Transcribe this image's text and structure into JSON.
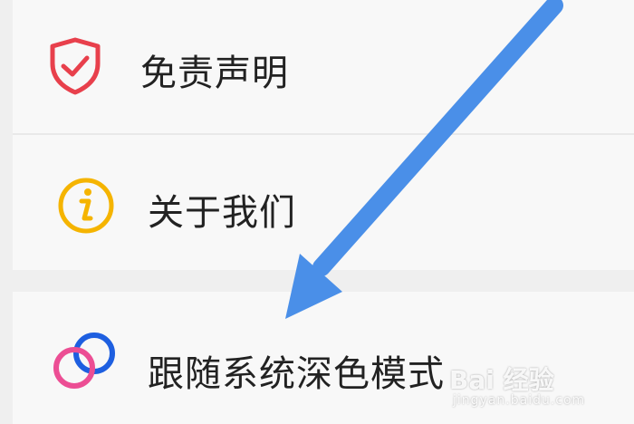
{
  "menu": {
    "items": [
      {
        "label": "免责声明",
        "icon": "shield-check-icon",
        "color": "#e8404c"
      },
      {
        "label": "关于我们",
        "icon": "info-icon",
        "color": "#f5b400"
      },
      {
        "label": "跟随系统深色模式",
        "icon": "dark-mode-rings-icon",
        "colors": [
          "#ec4e94",
          "#1e5fe0"
        ]
      }
    ]
  },
  "annotation": {
    "type": "arrow",
    "color": "#4a8fe8"
  },
  "watermark": {
    "brand": "Bai 经验",
    "url": "jingyan.baidu.com"
  }
}
